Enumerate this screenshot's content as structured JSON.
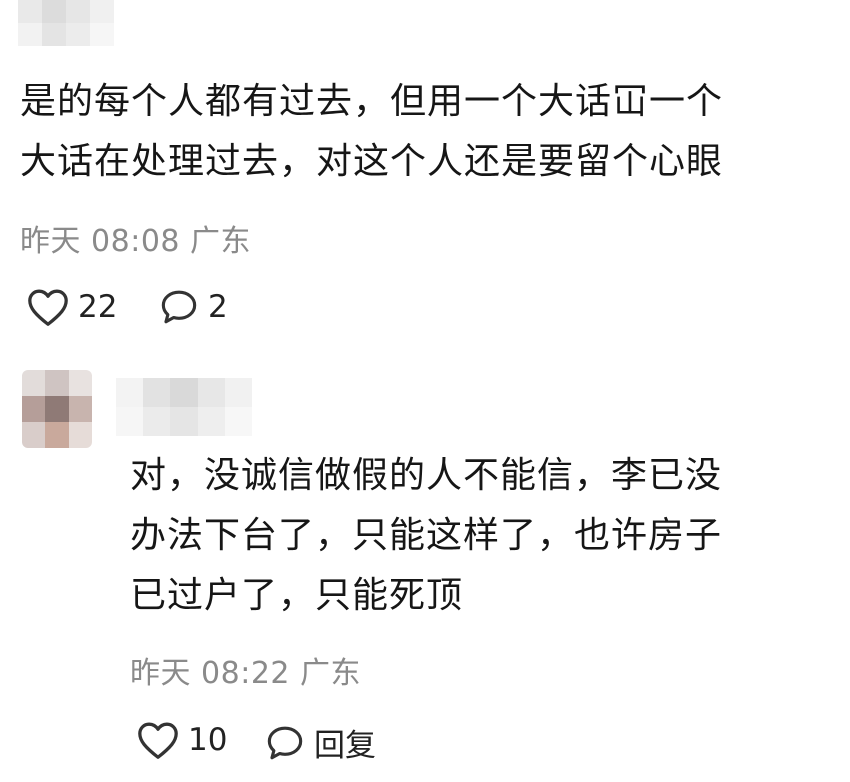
{
  "comments": [
    {
      "lines": [
        "是的每个人都有过去，但用一个大话冚一个",
        "大话在处理过去，对这个人还是要留个心眼"
      ],
      "time": "昨天 08:08",
      "location": "广东",
      "likes": "22",
      "replies": "2"
    },
    {
      "lines": [
        "对，没诚信做假的人不能信，李已没",
        "办法下台了，只能这样了，也许房子",
        "已过户了，只能死顶"
      ],
      "time": "昨天 08:22",
      "location": "广东",
      "likes": "10",
      "reply_label": "回复"
    }
  ],
  "icons": {
    "like": "heart-outline-icon",
    "comment": "speech-bubble-icon"
  },
  "colors": {
    "text": "#161616",
    "meta": "#8a8a8a",
    "icon": "#333333",
    "background": "#ffffff"
  }
}
